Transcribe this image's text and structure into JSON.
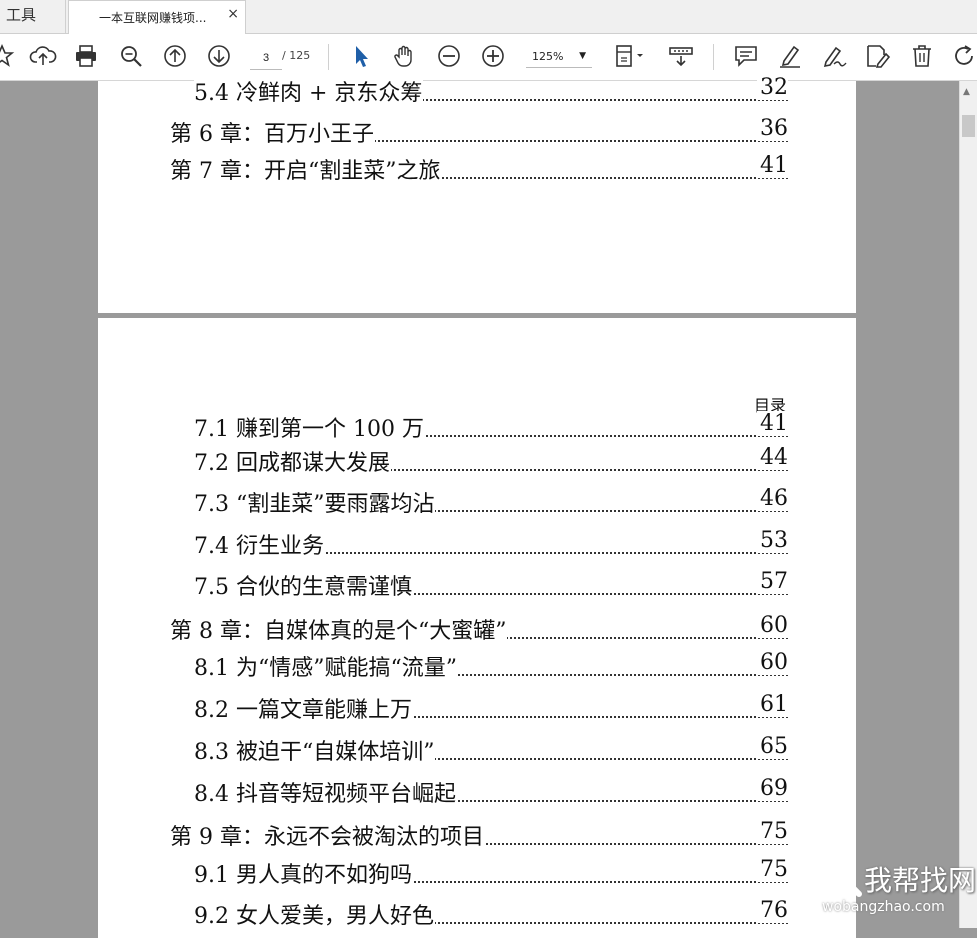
{
  "tabs": {
    "tools_label": "工具",
    "doc_label": "一本互联网赚钱项...",
    "close": "×"
  },
  "toolbar": {
    "page_current": "3",
    "page_total": "/ 125",
    "zoom": "125%",
    "icons": [
      "star-icon",
      "cloud-upload-icon",
      "print-icon",
      "zoom-out-search-icon",
      "page-up-icon",
      "page-down-icon",
      "select-cursor-icon",
      "hand-tool-icon",
      "zoom-minus-icon",
      "zoom-plus-icon",
      "fit-page-icon",
      "scroll-mode-icon",
      "comment-icon",
      "highlight-icon",
      "sign-icon",
      "edit-icon",
      "delete-icon",
      "rotate-icon"
    ],
    "accent": "#1f5fa8"
  },
  "page1": {
    "rows": [
      {
        "label": "5.4 冷鲜肉 + 京东众筹",
        "page": "32",
        "kind": "sec"
      },
      {
        "label": "第 6 章：百万小王子",
        "page": "36",
        "kind": "ch"
      },
      {
        "label": "第 7 章：开启“割韭菜”之旅",
        "page": "41",
        "kind": "ch"
      }
    ]
  },
  "page2": {
    "header": "目录",
    "rows": [
      {
        "label": "7.1 赚到第一个 100 万",
        "page": "41",
        "kind": "sec"
      },
      {
        "label": "7.2 回成都谋大发展",
        "page": "44",
        "kind": "sec"
      },
      {
        "label": "7.3 “割韭菜”要雨露均沾",
        "page": "46",
        "kind": "sec"
      },
      {
        "label": "7.4 衍生业务",
        "page": "53",
        "kind": "sec"
      },
      {
        "label": "7.5 合伙的生意需谨慎",
        "page": "57",
        "kind": "sec"
      },
      {
        "label": "第 8 章：自媒体真的是个“大蜜罐”",
        "page": "60",
        "kind": "ch"
      },
      {
        "label": "8.1 为“情感”赋能搞“流量”",
        "page": "60",
        "kind": "sec"
      },
      {
        "label": "8.2 一篇文章能赚上万",
        "page": "61",
        "kind": "sec"
      },
      {
        "label": "8.3 被迫干“自媒体培训”",
        "page": "65",
        "kind": "sec"
      },
      {
        "label": "8.4 抖音等短视频平台崛起",
        "page": "69",
        "kind": "sec"
      },
      {
        "label": "第 9 章：永远不会被淘汰的项目",
        "page": "75",
        "kind": "ch"
      },
      {
        "label": "9.1 男人真的不如狗吗",
        "page": "75",
        "kind": "sec"
      },
      {
        "label": "9.2 女人爱美，男人好色",
        "page": "76",
        "kind": "sec"
      }
    ]
  },
  "watermark": {
    "name": "我帮找网",
    "url": "wobangzhao.com"
  }
}
